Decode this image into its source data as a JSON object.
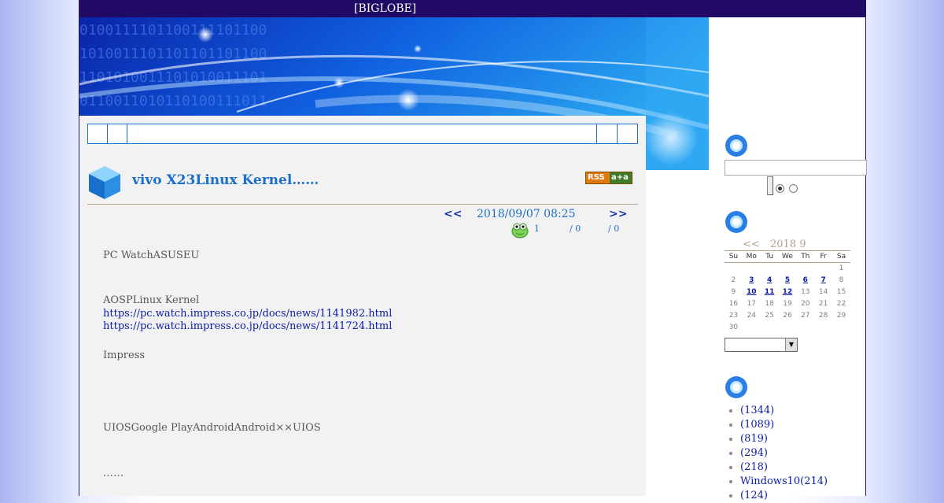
{
  "topbar": {
    "brand": "[BIGLOBE]"
  },
  "entry": {
    "title": "vivo X23Linux Kernel……",
    "rss_left": "RSS",
    "rss_right": "a+a",
    "prev": "<<",
    "next": ">>",
    "date": "2018/09/07 08:25",
    "counts": [
      "1",
      "/ 0",
      "/ 0"
    ],
    "paragraphs": [
      "PC WatchASUSEU",
      "AOSPLinux Kernel",
      "Impress",
      "UIOSGoogle PlayAndroidAndroid××UIOS",
      "……"
    ],
    "links": [
      "https://pc.watch.impress.co.jp/docs/news/1141982.html",
      "https://pc.watch.impress.co.jp/docs/news/1141724.html"
    ]
  },
  "calendar": {
    "prev": "<<",
    "label": "2018 9",
    "weekdays": [
      "Su",
      "Mo",
      "Tu",
      "We",
      "Th",
      "Fr",
      "Sa"
    ],
    "weeks": [
      [
        "",
        "",
        "",
        "",
        "",
        "",
        "1"
      ],
      [
        "2",
        "3",
        "4",
        "5",
        "6",
        "7",
        "8"
      ],
      [
        "9",
        "10",
        "11",
        "12",
        "13",
        "14",
        "15"
      ],
      [
        "16",
        "17",
        "18",
        "19",
        "20",
        "21",
        "22"
      ],
      [
        "23",
        "24",
        "25",
        "26",
        "27",
        "28",
        "29"
      ],
      [
        "30",
        "",
        "",
        "",
        "",
        "",
        ""
      ]
    ],
    "linked_days": [
      "3",
      "4",
      "5",
      "6",
      "7",
      "10",
      "11",
      "12"
    ]
  },
  "categories": [
    "(1344)",
    "(1089)",
    "(819)",
    "(294)",
    "(218)",
    "Windows10(214)",
    "(124)"
  ],
  "colors": {
    "topbar": "#200a66",
    "accent": "#1a6fcc",
    "link": "#0a1aa8",
    "content_bg": "#f2f2f2"
  }
}
